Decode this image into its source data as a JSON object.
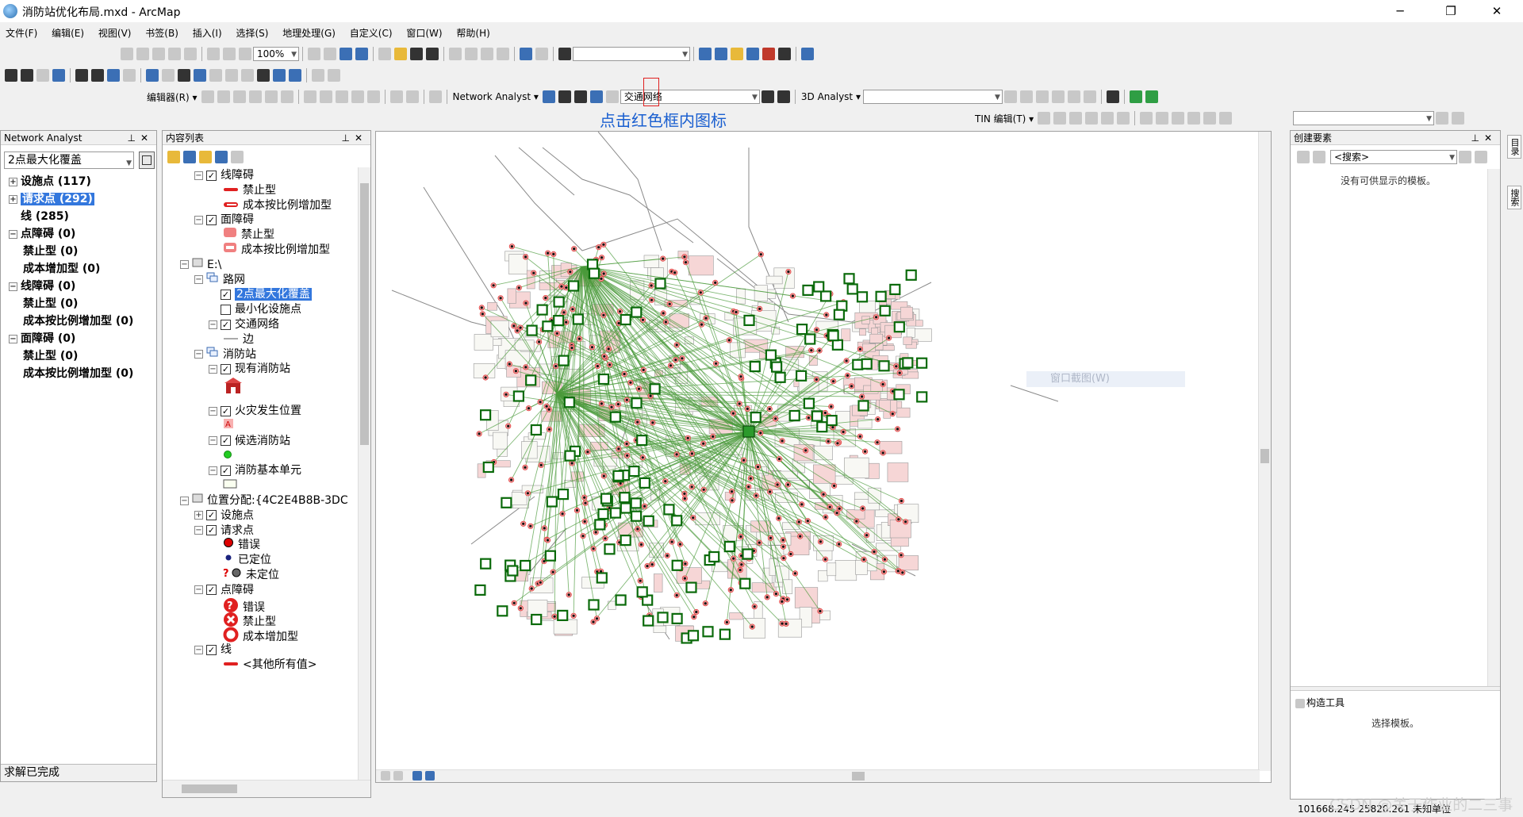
{
  "window": {
    "title": "消防站优化布局.mxd - ArcMap",
    "minimize": "─",
    "maximize": "❐",
    "close": "✕"
  },
  "menu": [
    "文件(F)",
    "编辑(E)",
    "视图(V)",
    "书签(B)",
    "插入(I)",
    "选择(S)",
    "地理处理(G)",
    "自定义(C)",
    "窗口(W)",
    "帮助(H)"
  ],
  "toolbar": {
    "zoom_value": "100%",
    "editor_label": "编辑器(R) ▾",
    "network_analyst_label": "Network Analyst ▾",
    "network_dataset": "交通网络",
    "analyst3d_label": "3D Analyst ▾",
    "tin_label": "TIN 编辑(T) ▾",
    "annotation": "点击红色框内图标"
  },
  "network_analyst_panel": {
    "title": "Network Analyst",
    "layer_select": "2点最大化覆盖",
    "items": [
      {
        "label": "设施点 (117)",
        "level": 0,
        "expander": "+",
        "selected": false
      },
      {
        "label": "请求点 (292)",
        "level": 0,
        "expander": "+",
        "selected": true
      },
      {
        "label": "线 (285)",
        "level": 0,
        "expander": "",
        "selected": false
      },
      {
        "label": "点障碍 (0)",
        "level": 0,
        "expander": "−",
        "selected": false
      },
      {
        "label": "禁止型 (0)",
        "level": 1,
        "expander": "",
        "selected": false
      },
      {
        "label": "成本增加型 (0)",
        "level": 1,
        "expander": "",
        "selected": false
      },
      {
        "label": "线障碍 (0)",
        "level": 0,
        "expander": "−",
        "selected": false
      },
      {
        "label": "禁止型 (0)",
        "level": 1,
        "expander": "",
        "selected": false
      },
      {
        "label": "成本按比例增加型 (0)",
        "level": 1,
        "expander": "",
        "selected": false
      },
      {
        "label": "面障碍 (0)",
        "level": 0,
        "expander": "−",
        "selected": false
      },
      {
        "label": "禁止型 (0)",
        "level": 1,
        "expander": "",
        "selected": false
      },
      {
        "label": "成本按比例增加型 (0)",
        "level": 1,
        "expander": "",
        "selected": false
      }
    ],
    "status": "求解已完成"
  },
  "toc_panel": {
    "title": "内容列表",
    "rows": [
      {
        "label": "线障碍",
        "indent": 1,
        "expander": "−",
        "check": true,
        "symbol": ""
      },
      {
        "label": "禁止型",
        "indent": 3,
        "expander": "",
        "check": null,
        "symbol": "line-red"
      },
      {
        "label": "成本按比例增加型",
        "indent": 3,
        "expander": "",
        "check": null,
        "symbol": "line-red-hollow"
      },
      {
        "label": "面障碍",
        "indent": 1,
        "expander": "−",
        "check": true,
        "symbol": ""
      },
      {
        "label": "禁止型",
        "indent": 3,
        "expander": "",
        "check": null,
        "symbol": "poly-red"
      },
      {
        "label": "成本按比例增加型",
        "indent": 3,
        "expander": "",
        "check": null,
        "symbol": "poly-red-hatch"
      },
      {
        "label": "E:\\",
        "indent": 0,
        "expander": "−",
        "check": null,
        "symbol": "db"
      },
      {
        "label": "路网",
        "indent": 1,
        "expander": "−",
        "check": null,
        "symbol": "group"
      },
      {
        "label": "2点最大化覆盖",
        "indent": 2,
        "expander": "",
        "check": true,
        "symbol": "",
        "selected": true
      },
      {
        "label": "最小化设施点",
        "indent": 2,
        "expander": "",
        "check": false,
        "symbol": ""
      },
      {
        "label": "交通网络",
        "indent": 2,
        "expander": "−",
        "check": true,
        "symbol": ""
      },
      {
        "label": "边",
        "indent": 3,
        "expander": "",
        "check": null,
        "symbol": "line-gray"
      },
      {
        "label": "消防站",
        "indent": 1,
        "expander": "−",
        "check": null,
        "symbol": "group"
      },
      {
        "label": "现有消防站",
        "indent": 2,
        "expander": "−",
        "check": true,
        "symbol": ""
      },
      {
        "label": "",
        "indent": 3,
        "expander": "",
        "check": null,
        "symbol": "firestation",
        "tall": true
      },
      {
        "label": "火灾发生位置",
        "indent": 2,
        "expander": "−",
        "check": true,
        "symbol": ""
      },
      {
        "label": "",
        "indent": 3,
        "expander": "",
        "check": null,
        "symbol": "fire-icon"
      },
      {
        "label": "候选消防站",
        "indent": 2,
        "expander": "−",
        "check": true,
        "symbol": ""
      },
      {
        "label": "",
        "indent": 3,
        "expander": "",
        "check": null,
        "symbol": "green-dot"
      },
      {
        "label": "消防基本单元",
        "indent": 2,
        "expander": "−",
        "check": true,
        "symbol": ""
      },
      {
        "label": "",
        "indent": 3,
        "expander": "",
        "check": null,
        "symbol": "poly-empty"
      },
      {
        "label": "位置分配:{4C2E4B8B-3DC",
        "indent": 0,
        "expander": "−",
        "check": null,
        "symbol": "db"
      },
      {
        "label": "设施点",
        "indent": 1,
        "expander": "+",
        "check": true,
        "symbol": ""
      },
      {
        "label": "请求点",
        "indent": 1,
        "expander": "−",
        "check": true,
        "symbol": ""
      },
      {
        "label": "错误",
        "indent": 3,
        "expander": "",
        "check": null,
        "symbol": "dot-red"
      },
      {
        "label": "已定位",
        "indent": 3,
        "expander": "",
        "check": null,
        "symbol": "dot-navy"
      },
      {
        "label": "未定位",
        "indent": 3,
        "expander": "",
        "check": null,
        "symbol": "dot-q"
      },
      {
        "label": "点障碍",
        "indent": 1,
        "expander": "−",
        "check": true,
        "symbol": ""
      },
      {
        "label": "错误",
        "indent": 3,
        "expander": "",
        "check": null,
        "symbol": "q-red"
      },
      {
        "label": "禁止型",
        "indent": 3,
        "expander": "",
        "check": null,
        "symbol": "x-red"
      },
      {
        "label": "成本增加型",
        "indent": 3,
        "expander": "",
        "check": null,
        "symbol": "ring-red"
      },
      {
        "label": "线",
        "indent": 1,
        "expander": "−",
        "check": true,
        "symbol": ""
      },
      {
        "label": "<其他所有值>",
        "indent": 3,
        "expander": "",
        "check": null,
        "symbol": "line-red"
      }
    ]
  },
  "create_features_panel": {
    "title": "创建要素",
    "search_placeholder": "<搜索>",
    "empty_msg": "没有可供显示的模板。",
    "construct_title": "构造工具",
    "construct_msg": "选择模板。"
  },
  "right_tabs": [
    "目录",
    "搜索"
  ],
  "map": {
    "context_ghost": "窗口截图(W)"
  },
  "status": {
    "coords": "101668.245  25820.261 未知单位",
    "watermark": "CSDN @关于作业的二三事"
  }
}
